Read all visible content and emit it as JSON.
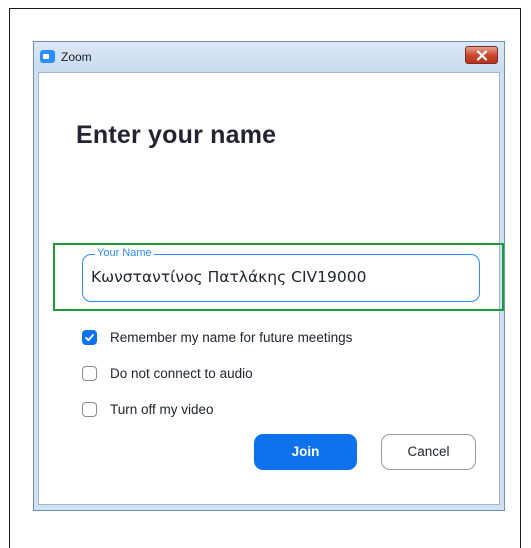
{
  "window": {
    "title": "Zoom",
    "icon": "zoom-app-icon",
    "close_icon": "close-icon"
  },
  "dialog": {
    "heading": "Enter your name",
    "name_field": {
      "label": "Your Name",
      "value": "Κωνσταντίνος Πατλάκης CIV19000"
    },
    "options": [
      {
        "label": "Remember my name for future meetings",
        "checked": true
      },
      {
        "label": "Do not connect to audio",
        "checked": false
      },
      {
        "label": "Turn off my video",
        "checked": false
      }
    ],
    "join_label": "Join",
    "cancel_label": "Cancel"
  },
  "colors": {
    "accent": "#0e72ed",
    "highlight": "#1f9a3a"
  }
}
